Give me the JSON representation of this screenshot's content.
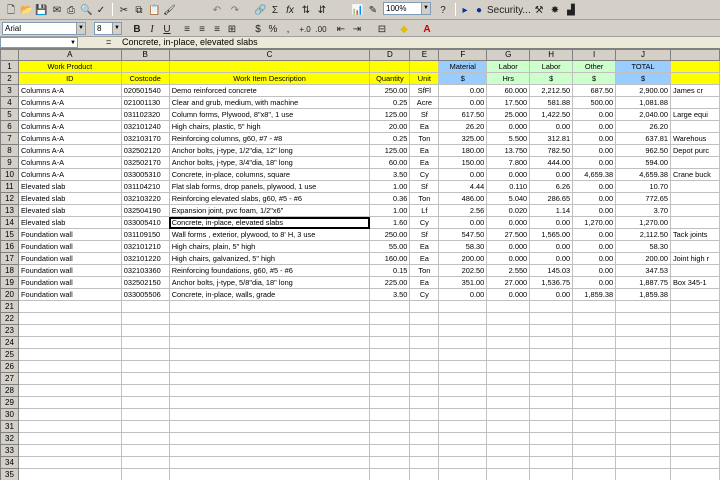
{
  "toolbar": {
    "font_name": "Arial",
    "font_size": "8",
    "zoom": "100%",
    "security_label": "Security...",
    "bold": "B",
    "italic": "I",
    "underline": "U",
    "currency": "$",
    "percent": "%",
    "comma": ",",
    "sum": "Σ",
    "fx": "fx"
  },
  "formula_bar": {
    "name_box": "",
    "fx_label": "=",
    "content": "Concrete, in-place, elevated slabs"
  },
  "columns": [
    "A",
    "B",
    "C",
    "D",
    "E",
    "F",
    "G",
    "H",
    "I",
    "J",
    ""
  ],
  "header_row1": [
    "Work Product",
    "",
    "",
    "",
    "",
    "Material",
    "Labor",
    "Labor",
    "Other",
    "TOTAL",
    ""
  ],
  "header_row2": [
    "ID",
    "Costcode",
    "Work Item Description",
    "Quantity",
    "Unit",
    "$",
    "Hrs",
    "$",
    "$",
    "$",
    ""
  ],
  "rows": [
    [
      "Columns A-A",
      "020501540",
      "Demo reinforced concrete",
      "250.00",
      "SfFl",
      "0.00",
      "60.000",
      "2,212.50",
      "687.50",
      "2,900.00",
      "James cr"
    ],
    [
      "Columns A-A",
      "021001130",
      "Clear and grub, medium, with machine",
      "0.25",
      "Acre",
      "0.00",
      "17.500",
      "581.88",
      "500.00",
      "1,081.88",
      ""
    ],
    [
      "Columns A-A",
      "031102320",
      "Column forms, Plywood, 8\"x8\", 1 use",
      "125.00",
      "Sf",
      "617.50",
      "25.000",
      "1,422.50",
      "0.00",
      "2,040.00",
      "Large equi"
    ],
    [
      "Columns A-A",
      "032101240",
      "High chairs, plastic, 5\" high",
      "20.00",
      "Ea",
      "26.20",
      "0.000",
      "0.00",
      "0.00",
      "26.20",
      ""
    ],
    [
      "Columns A-A",
      "032103170",
      "Reinforcing columns, g60, #7 - #8",
      "0.25",
      "Ton",
      "325.00",
      "5.500",
      "312.81",
      "0.00",
      "637.81",
      "Warehous"
    ],
    [
      "Columns A-A",
      "032502120",
      "Anchor bolts, j-type, 1/2\"dia, 12\" long",
      "125.00",
      "Ea",
      "180.00",
      "13.750",
      "782.50",
      "0.00",
      "962.50",
      "Depot purc"
    ],
    [
      "Columns A-A",
      "032502170",
      "Anchor bolts, j-type, 3/4\"dia, 18\" long",
      "60.00",
      "Ea",
      "150.00",
      "7.800",
      "444.00",
      "0.00",
      "594.00",
      ""
    ],
    [
      "Columns A-A",
      "033005310",
      "Concrete, in-place, columns, square",
      "3.50",
      "Cy",
      "0.00",
      "0.000",
      "0.00",
      "4,659.38",
      "4,659.38",
      "Crane buck"
    ],
    [
      "Elevated slab",
      "031104210",
      "Flat slab forms, drop panels, plywood, 1 use",
      "1.00",
      "Sf",
      "4.44",
      "0.110",
      "6.26",
      "0.00",
      "10.70",
      ""
    ],
    [
      "Elevated slab",
      "032103220",
      "Reinforcing elevated slabs, g60, #5 - #6",
      "0.36",
      "Ton",
      "486.00",
      "5.040",
      "286.65",
      "0.00",
      "772.65",
      ""
    ],
    [
      "Elevated slab",
      "032504190",
      "Expansion joint, pvc foam, 1/2\"x6\"",
      "1.00",
      "Lf",
      "2.56",
      "0.020",
      "1.14",
      "0.00",
      "3.70",
      ""
    ],
    [
      "Elevated slab",
      "033005410",
      "Concrete, in-place, elevated slabs",
      "1.60",
      "Cy",
      "0.00",
      "0.000",
      "0.00",
      "1,270.00",
      "1,270.00",
      ""
    ],
    [
      "Foundation wall",
      "031109150",
      "Wall forms , exterior, plywood, to 8' H, 3 use",
      "250.00",
      "Sf",
      "547.50",
      "27.500",
      "1,565.00",
      "0.00",
      "2,112.50",
      "Tack joints"
    ],
    [
      "Foundation wall",
      "032101210",
      "High chairs, plain, 5\" high",
      "55.00",
      "Ea",
      "58.30",
      "0.000",
      "0.00",
      "0.00",
      "58.30",
      ""
    ],
    [
      "Foundation wall",
      "032101220",
      "High chairs, galvanized, 5\" high",
      "160.00",
      "Ea",
      "200.00",
      "0.000",
      "0.00",
      "0.00",
      "200.00",
      "Joint high r"
    ],
    [
      "Foundation wall",
      "032103360",
      "Reinforcing foundations, g60, #5 - #6",
      "0.15",
      "Ton",
      "202.50",
      "2.550",
      "145.03",
      "0.00",
      "347.53",
      ""
    ],
    [
      "Foundation wall",
      "032502150",
      "Anchor bolts, j-type, 5/8\"dia, 18\" long",
      "225.00",
      "Ea",
      "351.00",
      "27.000",
      "1,536.75",
      "0.00",
      "1,887.75",
      "Box 345-1"
    ],
    [
      "Foundation wall",
      "033005506",
      "Concrete, in-place, walls, grade",
      "3.50",
      "Cy",
      "0.00",
      "0.000",
      "0.00",
      "1,859.38",
      "1,859.38",
      ""
    ]
  ],
  "empty_rows": [
    "21",
    "22",
    "23",
    "24",
    "25",
    "26",
    "27",
    "28",
    "29",
    "30",
    "31",
    "32",
    "33",
    "34",
    "35"
  ]
}
